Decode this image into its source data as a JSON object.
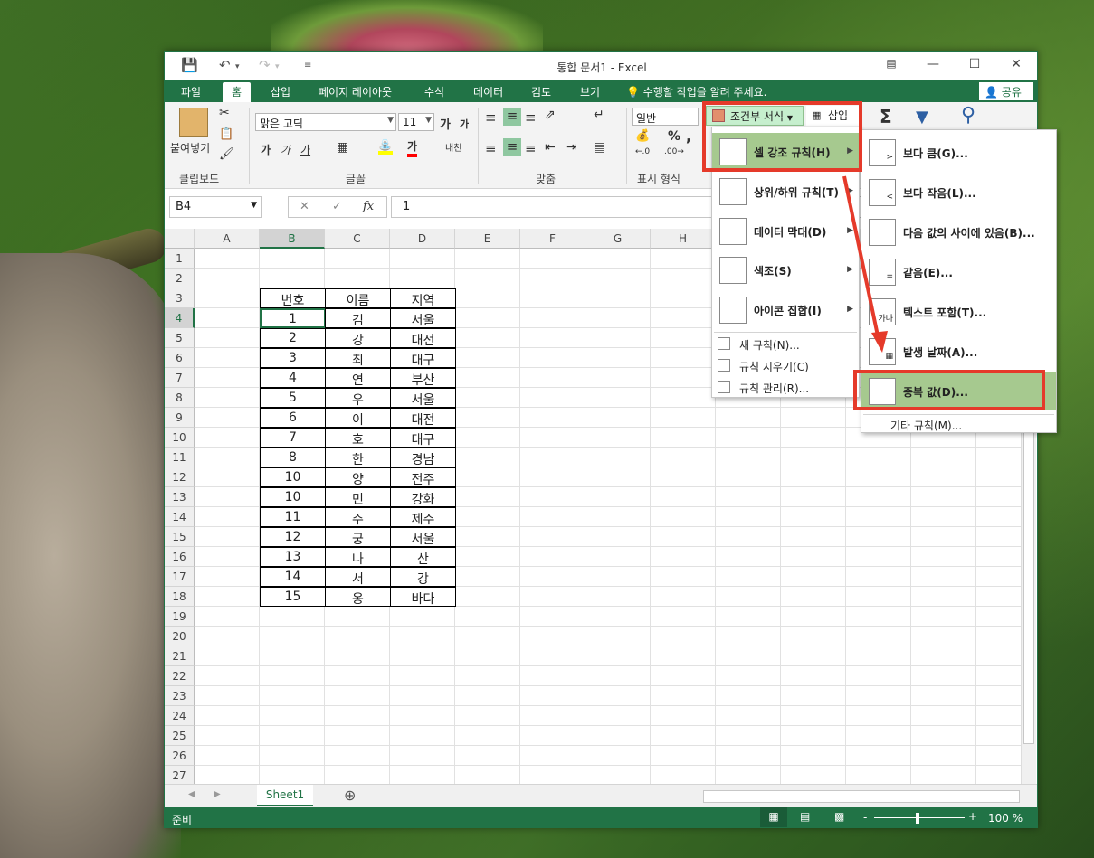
{
  "window": {
    "title": "통합 문서1 - Excel"
  },
  "tabs": [
    "파일",
    "홈",
    "삽입",
    "페이지 레이아웃",
    "수식",
    "데이터",
    "검토",
    "보기"
  ],
  "tell_me": "수행할 작업을 알려 주세요.",
  "share": "공유",
  "ribbon": {
    "paste_label": "붙여넣기",
    "clipboard": "클립보드",
    "font_name": "맑은 고딕",
    "font_size": "11",
    "font_group": "글꼴",
    "align_group": "맞춤",
    "number_format": "일반",
    "number_group": "표시 형식",
    "percent": "%",
    "comma": ",",
    "conditional_format": "조건부 서식",
    "insert_cells": "삽입",
    "sum": "Σ"
  },
  "formula_bar": {
    "name_box": "B4",
    "fx": "fx",
    "value": "1"
  },
  "columns": [
    "A",
    "B",
    "C",
    "D",
    "E",
    "F",
    "G",
    "H"
  ],
  "rows": [
    "1",
    "2",
    "3",
    "4",
    "5",
    "6",
    "7",
    "8",
    "9",
    "10",
    "11",
    "12",
    "13",
    "14",
    "15",
    "16",
    "17",
    "18",
    "19",
    "20",
    "21",
    "22",
    "23",
    "24",
    "25",
    "26",
    "27"
  ],
  "table": {
    "headers": [
      "번호",
      "이름",
      "지역"
    ],
    "data": [
      [
        "1",
        "김",
        "서울"
      ],
      [
        "2",
        "강",
        "대전"
      ],
      [
        "3",
        "최",
        "대구"
      ],
      [
        "4",
        "연",
        "부산"
      ],
      [
        "5",
        "우",
        "서울"
      ],
      [
        "6",
        "이",
        "대전"
      ],
      [
        "7",
        "호",
        "대구"
      ],
      [
        "8",
        "한",
        "경남"
      ],
      [
        "10",
        "양",
        "전주"
      ],
      [
        "10",
        "민",
        "강화"
      ],
      [
        "11",
        "주",
        "제주"
      ],
      [
        "12",
        "궁",
        "서울"
      ],
      [
        "13",
        "나",
        "산"
      ],
      [
        "14",
        "서",
        "강"
      ],
      [
        "15",
        "옹",
        "바다"
      ]
    ]
  },
  "sheet_tab": "Sheet1",
  "status": {
    "ready": "준비",
    "zoom": "100 %",
    "minus": "-",
    "plus": "+"
  },
  "cf_menu": {
    "items": [
      {
        "label": "셀 강조 규칙(H)",
        "icon": "highlight-cells-icon",
        "submenu": true,
        "highlighted": true
      },
      {
        "label": "상위/하위 규칙(T)",
        "icon": "top-bottom-icon",
        "submenu": true
      },
      {
        "label": "데이터 막대(D)",
        "icon": "data-bars-icon",
        "submenu": true
      },
      {
        "label": "색조(S)",
        "icon": "color-scales-icon",
        "submenu": true
      },
      {
        "label": "아이콘 집합(I)",
        "icon": "icon-sets-icon",
        "submenu": true
      }
    ],
    "small_items": [
      "새 규칙(N)...",
      "규칙 지우기(C)",
      "규칙 관리(R)..."
    ]
  },
  "highlight_menu": {
    "items": [
      "보다 큼(G)...",
      "보다 작음(L)...",
      "다음 값의 사이에 있음(B)...",
      "같음(E)...",
      "텍스트 포함(T)...",
      "발생 날짜(A)...",
      "중복 값(D)..."
    ],
    "more": "기타 규칙(M)...",
    "icon_glyphs": [
      ">",
      "<",
      "",
      "=",
      "가나",
      "▦",
      ""
    ],
    "highlighted_index": 6
  },
  "colors": {
    "accent": "#217346",
    "highlight": "#a6c98f",
    "callout": "#e53a2a"
  }
}
